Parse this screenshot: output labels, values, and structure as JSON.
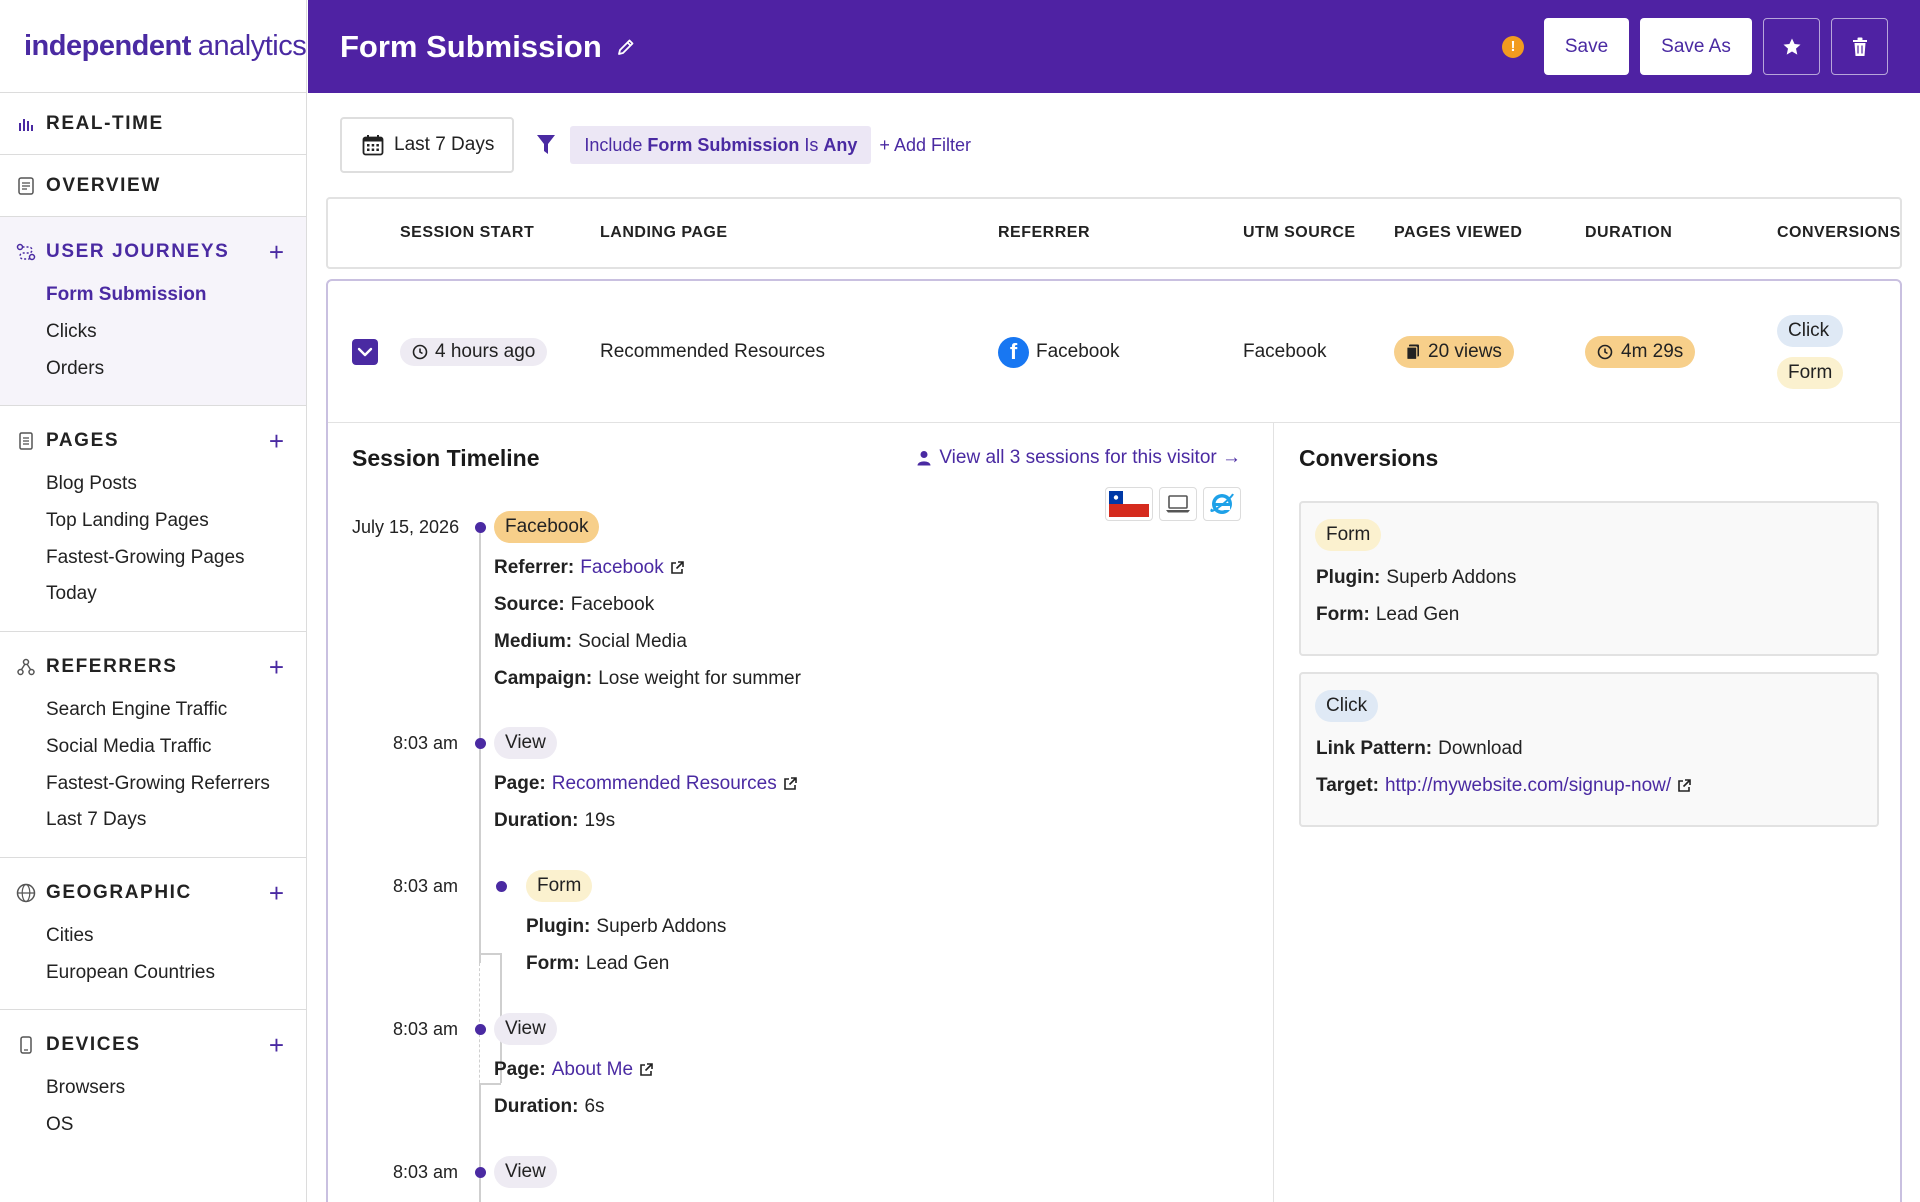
{
  "brand": {
    "word1": "independent",
    "word2": "analytics"
  },
  "sidebar": {
    "realtime": "REAL-TIME",
    "overview": "OVERVIEW",
    "groups": [
      {
        "title": "USER JOURNEYS",
        "items": [
          "Form Submission",
          "Clicks",
          "Orders"
        ]
      },
      {
        "title": "PAGES",
        "items": [
          "Blog Posts",
          "Top Landing Pages",
          "Fastest-Growing Pages",
          "Today"
        ]
      },
      {
        "title": "REFERRERS",
        "items": [
          "Search Engine Traffic",
          "Social Media Traffic",
          "Fastest-Growing Referrers",
          "Last 7 Days"
        ]
      },
      {
        "title": "GEOGRAPHIC",
        "items": [
          "Cities",
          "European Countries"
        ]
      },
      {
        "title": "DEVICES",
        "items": [
          "Browsers",
          "OS"
        ]
      }
    ],
    "plus": "+"
  },
  "header": {
    "title": "Form Submission",
    "warning": "!",
    "save": "Save",
    "save_as": "Save As"
  },
  "filters": {
    "date_range": "Last 7 Days",
    "chip": {
      "include": "Include ",
      "field": "Form Submission",
      "op": " Is ",
      "value": "Any"
    },
    "add_filter": "+ Add Filter"
  },
  "table": {
    "columns": [
      "SESSION START",
      "LANDING PAGE",
      "REFERRER",
      "UTM SOURCE",
      "PAGES VIEWED",
      "DURATION",
      "CONVERSIONS"
    ],
    "row": {
      "session_start": "4 hours ago",
      "landing_page": "Recommended Resources",
      "referrer": "Facebook",
      "referrer_logo": "f",
      "utm_source": "Facebook",
      "pages_viewed": "20 views",
      "duration": "4m 29s",
      "conversions": [
        "Click",
        "Form"
      ]
    }
  },
  "timeline": {
    "title": "Session Timeline",
    "visitor_link": "View all 3 sessions for this visitor →",
    "date": "July 15, 2026",
    "source_tag": "Facebook",
    "source_fields": {
      "referrer_label": "Referrer:",
      "referrer_value": "Facebook",
      "source_label": "Source:",
      "source_value": "Facebook",
      "medium_label": "Medium:",
      "medium_value": "Social Media",
      "campaign_label": "Campaign:",
      "campaign_value": "Lose weight for summer"
    },
    "events": [
      {
        "time": "8:03 am",
        "tag": "View",
        "field1_label": "Page:",
        "field1_value": "Recommended Resources",
        "field2_label": "Duration:",
        "field2_value": "19s"
      },
      {
        "time": "8:03 am",
        "tag": "Form",
        "field1_label": "Plugin:",
        "field1_value": "Superb Addons",
        "field2_label": "Form:",
        "field2_value": "Lead Gen"
      },
      {
        "time": "8:03 am",
        "tag": "View",
        "field1_label": "Page:",
        "field1_value": "About Me",
        "field2_label": "Duration:",
        "field2_value": "6s"
      },
      {
        "time": "8:03 am",
        "tag": "View"
      }
    ]
  },
  "conversions": {
    "title": "Conversions",
    "cards": [
      {
        "tag": "Form",
        "f1_label": "Plugin:",
        "f1_value": "Superb Addons",
        "f2_label": "Form:",
        "f2_value": "Lead Gen"
      },
      {
        "tag": "Click",
        "f1_label": "Link Pattern:",
        "f1_value": "Download",
        "f2_label": "Target:",
        "f2_value": "http://mywebsite.com/signup-now/"
      }
    ]
  },
  "colors": {
    "brand": "#4f22a3",
    "accent": "#4a2aa2",
    "orange_pill": "#f7cf8a",
    "click_tag": "#dfe9f5",
    "form_tag": "#fbf1cf"
  }
}
